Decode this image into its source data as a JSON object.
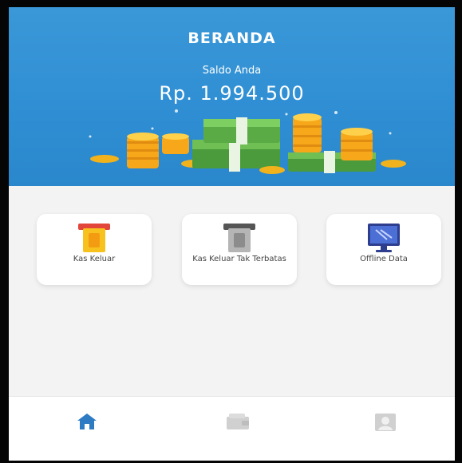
{
  "header": {
    "title": "BERANDA",
    "balance_label": "Saldo Anda",
    "balance_value": "Rp. 1.994.500"
  },
  "menu": [
    {
      "label": "Kas Keluar",
      "icon": "wallet-card-icon"
    },
    {
      "label": "Kas Keluar Tak Terbatas",
      "icon": "atm-card-icon"
    },
    {
      "label": "Offline Data",
      "icon": "monitor-icon"
    }
  ],
  "nav": [
    {
      "icon": "home-icon",
      "active": true
    },
    {
      "icon": "wallet-icon",
      "active": false
    },
    {
      "icon": "profile-icon",
      "active": false
    }
  ],
  "colors": {
    "primary": "#2f8ed3",
    "background": "#f3f3f3",
    "nav_active": "#2e7bc4",
    "nav_inactive": "#d0d0d0"
  }
}
